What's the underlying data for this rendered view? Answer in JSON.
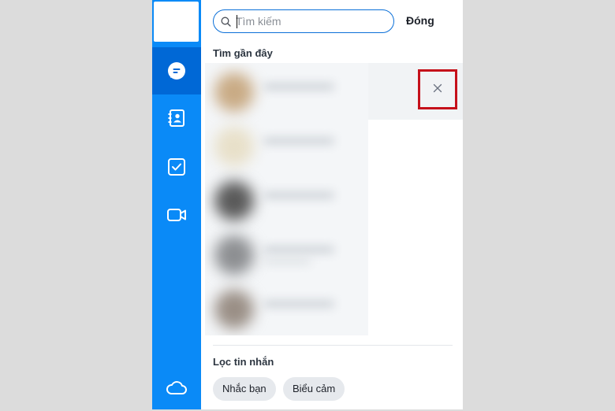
{
  "sidebar": {
    "items": [
      {
        "name": "messages",
        "icon": "chat-bubble-icon",
        "active": true
      },
      {
        "name": "contacts",
        "icon": "contact-book-icon",
        "active": false
      },
      {
        "name": "todo",
        "icon": "checkbox-icon",
        "active": false
      },
      {
        "name": "video-call",
        "icon": "video-camera-icon",
        "active": false
      },
      {
        "name": "cloud",
        "icon": "cloud-icon",
        "active": false
      }
    ]
  },
  "search": {
    "placeholder": "Tìm kiếm",
    "value": "",
    "close_label": "Đóng"
  },
  "recent": {
    "title": "Tìm gần đây",
    "remove_icon": "close-x-icon"
  },
  "filter": {
    "title": "Lọc tin nhắn",
    "chips": [
      "Nhắc bạn",
      "Biểu cảm"
    ]
  },
  "colors": {
    "sidebar": "#0a8af7",
    "sidebar_active": "#0068d6",
    "highlight_border": "#c5101a"
  }
}
